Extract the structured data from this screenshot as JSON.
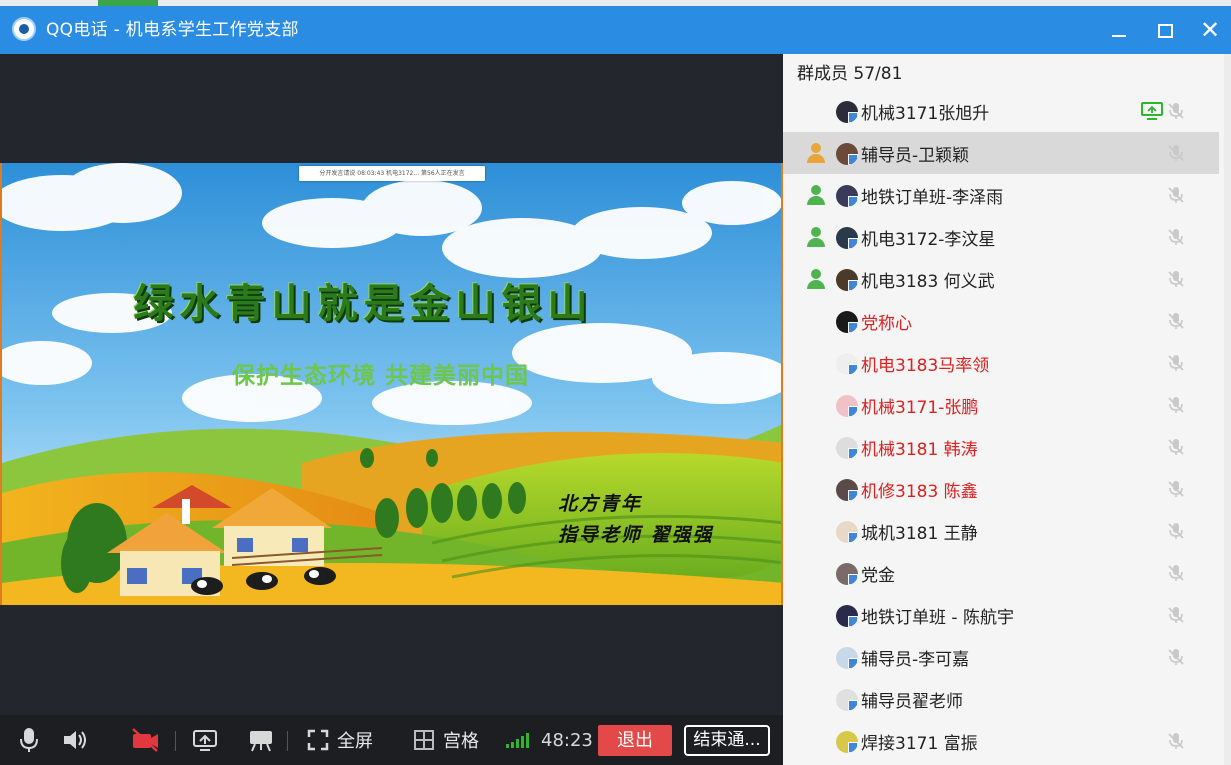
{
  "window": {
    "title": "QQ电话 - 机电系学生工作党支部",
    "minimize_icon": "minimize-icon",
    "maximize_icon": "maximize-icon",
    "close_glyph": "✕"
  },
  "shared_screen": {
    "top_bar_text": "分开发言请说  08:03:43  机电3172... 第56人正在发言",
    "slide": {
      "title": "绿水青山就是金山银山",
      "subtitle": "保护生态环境 共建美丽中国",
      "credit_line1": "北方青年",
      "credit_line2": "指导老师 翟强强"
    }
  },
  "toolbar": {
    "mic_icon": "microphone-icon",
    "speaker_icon": "speaker-icon",
    "camera_icon": "camera-off-icon",
    "screenshare_icon": "screen-share-icon",
    "whiteboard_icon": "presentation-icon",
    "fullscreen_label": "全屏",
    "grid_label": "宫格",
    "signal_icon": "signal-strength-icon",
    "timer": "48:23",
    "exit_label": "退出",
    "end_label": "结束通..."
  },
  "members": {
    "count_label": "群成员 57/81",
    "colors": {
      "normal": "#222222",
      "red": "#e02020",
      "host_green": "#4fb44f",
      "host_gold": "#e8a63a"
    },
    "rows": [
      {
        "name": "机械3171张旭升",
        "color": "normal",
        "host": "none",
        "sharing": true,
        "selected": false
      },
      {
        "name": "辅导员-卫颖颖",
        "color": "normal",
        "host": "gold",
        "sharing": false,
        "selected": true
      },
      {
        "name": "地铁订单班-李泽雨",
        "color": "normal",
        "host": "green",
        "sharing": false,
        "selected": false
      },
      {
        "name": "机电3172-李汶星",
        "color": "normal",
        "host": "green",
        "sharing": false,
        "selected": false
      },
      {
        "name": "机电3183 何义武",
        "color": "normal",
        "host": "green",
        "sharing": false,
        "selected": false
      },
      {
        "name": "党称心",
        "color": "red",
        "host": "none",
        "sharing": false,
        "selected": false
      },
      {
        "name": "机电3183马率领",
        "color": "red",
        "host": "none",
        "sharing": false,
        "selected": false
      },
      {
        "name": "机械3171-张鹏",
        "color": "red",
        "host": "none",
        "sharing": false,
        "selected": false
      },
      {
        "name": "机械3181  韩涛",
        "color": "red",
        "host": "none",
        "sharing": false,
        "selected": false
      },
      {
        "name": "机修3183 陈鑫",
        "color": "red",
        "host": "none",
        "sharing": false,
        "selected": false
      },
      {
        "name": "城机3181   王静",
        "color": "normal",
        "host": "none",
        "sharing": false,
        "selected": false
      },
      {
        "name": "党金",
        "color": "normal",
        "host": "none",
        "sharing": false,
        "selected": false
      },
      {
        "name": "地铁订单班 - 陈航宇",
        "color": "normal",
        "host": "none",
        "sharing": false,
        "selected": false
      },
      {
        "name": "辅导员-李可嘉",
        "color": "normal",
        "host": "none",
        "sharing": false,
        "selected": false
      },
      {
        "name": "辅导员翟老师",
        "color": "normal",
        "host": "none",
        "sharing": false,
        "selected": false,
        "no_mute": true
      },
      {
        "name": "焊接3171      富振",
        "color": "normal",
        "host": "none",
        "sharing": false,
        "selected": false
      }
    ]
  }
}
